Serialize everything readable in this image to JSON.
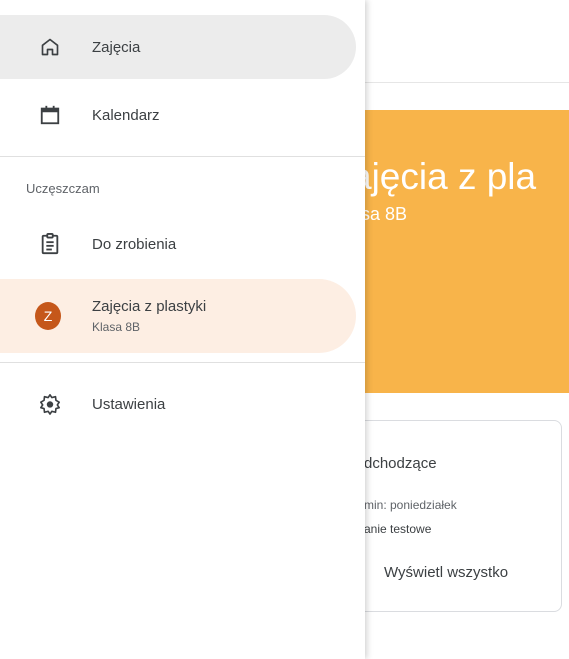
{
  "drawer": {
    "items": [
      {
        "label": "Zajęcia",
        "icon": "home-icon"
      },
      {
        "label": "Kalendarz",
        "icon": "calendar-icon"
      }
    ],
    "section_label": "Uczęszczam",
    "todo": {
      "label": "Do zrobienia",
      "icon": "assignment-icon"
    },
    "course": {
      "label": "Zajęcia z plastyki",
      "sublabel": "Klasa 8B",
      "avatar_letter": "Z",
      "avatar_color": "#c5571a"
    },
    "settings": {
      "label": "Ustawienia",
      "icon": "gear-icon"
    }
  },
  "banner": {
    "title": "ajęcia z pla",
    "subtitle": "asa 8B",
    "color": "#f8b44a"
  },
  "upcoming": {
    "title": "dchodzące",
    "due": "min: poniedziałek",
    "item": "anie testowe",
    "view_all": "Wyświetl wszystko"
  }
}
